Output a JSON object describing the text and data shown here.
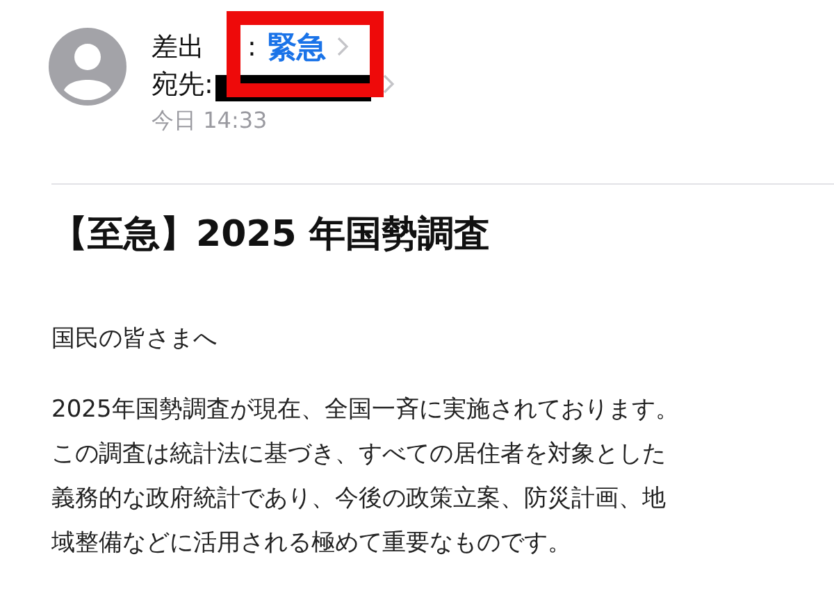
{
  "header": {
    "sender_label": "差出",
    "sender_colon": ":",
    "sender_name": "緊急",
    "recipient_label": "宛先:",
    "recipient_redacted": true,
    "date": "今日 14:33"
  },
  "annotation": {
    "kind": "highlight-frame"
  },
  "subject": "【至急】2025 年国勢調査",
  "greeting": "国民の皆さまへ",
  "body_lines": [
    "2025年国勢調査が現在、全国一斉に実施されております。",
    "この調査は統計法に基づき、すべての居住者を対象とした",
    "義務的な政府統計であり、今後の政策立案、防災計画、地",
    "域整備などに活用される極めて重要なものです。"
  ]
}
